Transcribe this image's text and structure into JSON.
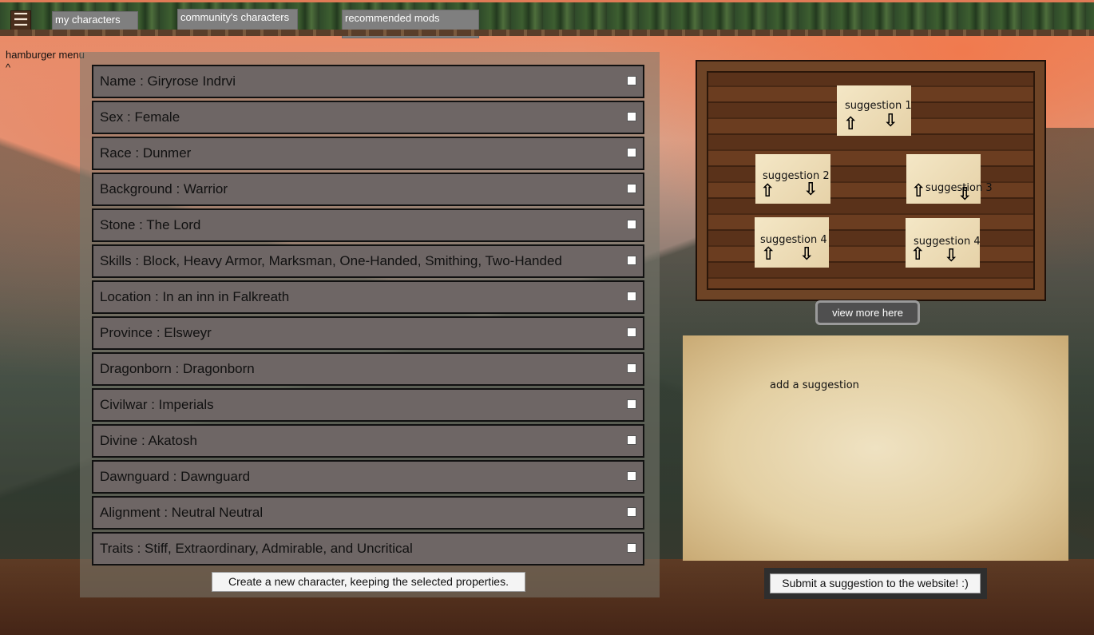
{
  "nav": {
    "menu_icon": "hamburger-icon",
    "my_characters": "my characters",
    "community_characters": "community's characters",
    "recommended_mods": "recommended mods"
  },
  "hamburger_label": {
    "line1": "hamburger menu",
    "line2": "^"
  },
  "properties": [
    {
      "label": "Name : Giryrose Indrvi",
      "checked": false
    },
    {
      "label": "Sex : Female",
      "checked": false
    },
    {
      "label": "Race : Dunmer",
      "checked": false
    },
    {
      "label": "Background : Warrior",
      "checked": false
    },
    {
      "label": "Stone : The Lord",
      "checked": false
    },
    {
      "label": "Skills : Block, Heavy Armor, Marksman, One-Handed, Smithing, Two-Handed",
      "checked": false
    },
    {
      "label": "Location : In an inn in Falkreath",
      "checked": false
    },
    {
      "label": "Province : Elsweyr",
      "checked": false
    },
    {
      "label": "Dragonborn : Dragonborn",
      "checked": false
    },
    {
      "label": "Civilwar : Imperials",
      "checked": false
    },
    {
      "label": "Divine : Akatosh",
      "checked": false
    },
    {
      "label": "Dawnguard : Dawnguard",
      "checked": false
    },
    {
      "label": "Alignment : Neutral Neutral",
      "checked": false
    },
    {
      "label": "Traits : Stiff, Extraordinary, Admirable, and Uncritical",
      "checked": false
    }
  ],
  "create_button": "Create a new character, keeping the selected properties.",
  "suggestions": [
    {
      "label": "suggestion  1"
    },
    {
      "label": "suggestion 2"
    },
    {
      "label": "suggestion 3"
    },
    {
      "label": "suggestion 4"
    },
    {
      "label": "suggestion 4"
    }
  ],
  "view_more": "view more here",
  "add_suggestion": "add a suggestion",
  "submit_button": "Submit a suggestion to the website! :)"
}
